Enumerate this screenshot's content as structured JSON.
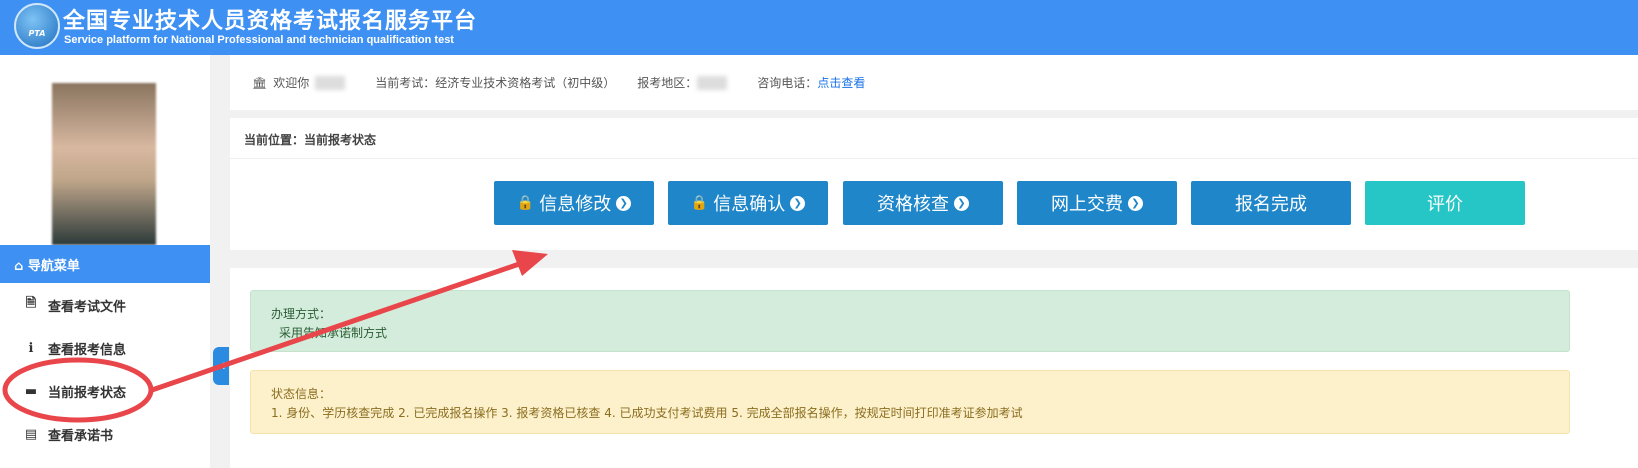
{
  "header": {
    "logo_text": "PTA",
    "title": "全国专业技术人员资格考试报名服务平台",
    "subtitle": "Service platform for National Professional and technician qualification test"
  },
  "sidebar": {
    "nav_title": "导航菜单",
    "items": [
      {
        "label": "查看考试文件",
        "icon": "file-icon"
      },
      {
        "label": "查看报考信息",
        "icon": "info-icon"
      },
      {
        "label": "当前报考状态",
        "icon": "monitor-icon"
      },
      {
        "label": "查看承诺书",
        "icon": "newspaper-icon"
      }
    ]
  },
  "infobar": {
    "welcome": "欢迎你",
    "exam_label": "当前考试：",
    "exam": "经济专业技术资格考试（初中级）",
    "region_label": "报考地区：",
    "phone_label": "咨询电话：",
    "phone_link": "点击查看"
  },
  "breadcrumb": "当前位置：当前报考状态",
  "steps": [
    {
      "label": "信息修改",
      "locked": true
    },
    {
      "label": "信息确认",
      "locked": true
    },
    {
      "label": "资格核查",
      "locked": false
    },
    {
      "label": "网上交费",
      "locked": false
    },
    {
      "label": "报名完成"
    },
    {
      "label": "评价"
    }
  ],
  "method": {
    "title": "办理方式：",
    "text": "采用告知承诺制方式"
  },
  "status": {
    "title": "状态信息：",
    "text": "1. 身份、学历核查完成 2. 已完成报名操作 3. 报考资格已核查 4. 已成功支付考试费用 5. 完成全部报名操作，按规定时间打印准考证参加考试"
  },
  "colors": {
    "brand": "#3e90f2",
    "step": "#1f87c9",
    "rate": "#26c6c6"
  }
}
